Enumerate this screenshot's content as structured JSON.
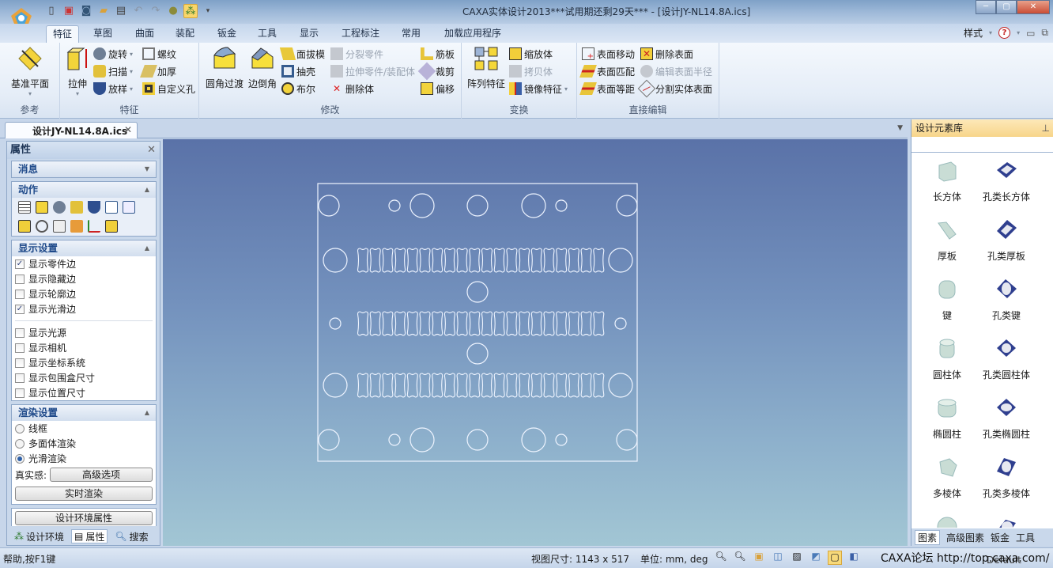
{
  "window": {
    "title": "CAXA实体设计2013***试用期还剩29天*** - [设计JY-NL14.8A.ics]",
    "controls": [
      "minimize",
      "maximize",
      "close"
    ]
  },
  "quick_access": [
    "new-icon",
    "new-drawing-icon",
    "new-design-icon",
    "open-icon",
    "save-icon",
    "undo-icon",
    "redo-icon",
    "tools-icon",
    "design-tree-icon"
  ],
  "menu_tabs": [
    {
      "label": "特征",
      "active": true
    },
    {
      "label": "草图"
    },
    {
      "label": "曲面"
    },
    {
      "label": "装配"
    },
    {
      "label": "钣金"
    },
    {
      "label": "工具"
    },
    {
      "label": "显示"
    },
    {
      "label": "工程标注"
    },
    {
      "label": "常用"
    },
    {
      "label": "加载应用程序"
    }
  ],
  "ribbon_right": {
    "style_label": "样式",
    "help": "?"
  },
  "ribbon": {
    "groups": [
      {
        "label": "参考",
        "big": [
          {
            "label": "基准平面"
          }
        ]
      },
      {
        "label": "特征",
        "big": [
          {
            "label": "拉伸"
          }
        ],
        "small": [
          "旋转",
          "扫描",
          "放样",
          "螺纹",
          "加厚",
          "自定义孔"
        ]
      },
      {
        "label": "修改",
        "big": [
          {
            "label": "圆角过渡"
          },
          {
            "label": "边倒角"
          }
        ],
        "small": [
          "面拔模",
          "抽壳",
          "布尔",
          "分裂零件",
          "拉伸零件/装配体",
          "删除体",
          "筋板",
          "裁剪",
          "偏移"
        ]
      },
      {
        "label": "变换",
        "big": [
          {
            "label": "阵列特征"
          }
        ],
        "small": [
          "缩放体",
          "拷贝体",
          "镜像特征"
        ]
      },
      {
        "label": "直接编辑",
        "small": [
          "表面移动",
          "表面匹配",
          "表面等距",
          "删除表面",
          "编辑表面半径",
          "分割实体表面"
        ]
      }
    ]
  },
  "document_tab": {
    "label": "设计JY-NL14.8A.ics"
  },
  "left_panel": {
    "title": "属性",
    "sections": {
      "message": "消息",
      "actions": "动作",
      "display": "显示设置",
      "render": "渲染设置"
    },
    "display_options": [
      {
        "label": "显示零件边",
        "checked": true
      },
      {
        "label": "显示隐藏边",
        "checked": false
      },
      {
        "label": "显示轮廓边",
        "checked": false
      },
      {
        "label": "显示光滑边",
        "checked": true
      },
      {
        "label": "显示光源",
        "checked": false
      },
      {
        "label": "显示相机",
        "checked": false
      },
      {
        "label": "显示坐标系统",
        "checked": false
      },
      {
        "label": "显示包围盒尺寸",
        "checked": false
      },
      {
        "label": "显示位置尺寸",
        "checked": false
      }
    ],
    "render_options": [
      {
        "label": "线框",
        "selected": false
      },
      {
        "label": "多面体渲染",
        "selected": false
      },
      {
        "label": "光滑渲染",
        "selected": true
      }
    ],
    "realism_label": "真实感:",
    "advanced_button": "高级选项",
    "realtime_button": "实时渲染",
    "env_button": "设计环境属性",
    "tabs": [
      "设计环境",
      "属性",
      "搜索"
    ]
  },
  "right_panel": {
    "title": "设计元素库",
    "items": [
      "长方体",
      "孔类长方体",
      "厚板",
      "孔类厚板",
      "键",
      "孔类键",
      "圆柱体",
      "孔类圆柱体",
      "椭圆柱",
      "孔类椭圆柱",
      "多棱体",
      "孔类多棱体"
    ],
    "tabs": [
      "图素",
      "高级图素",
      "钣金",
      "工具"
    ]
  },
  "status": {
    "help": "帮助,按F1键",
    "view_size": "视图尺寸: 1143 x  517",
    "units": "单位: mm, deg",
    "overlay": "CAXA论坛 http://top.caxa.com/",
    "default": "Default"
  },
  "colors": {
    "viewport_top": "#5a72a8",
    "viewport_bottom": "#a2c6d4",
    "edge": "#eef4ff"
  }
}
